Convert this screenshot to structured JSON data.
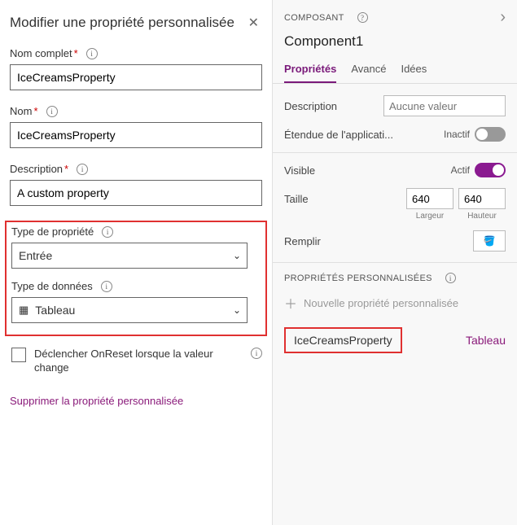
{
  "leftPanel": {
    "title": "Modifier une propriété personnalisée",
    "fields": {
      "fullNameLabel": "Nom complet",
      "fullNameValue": "IceCreamsProperty",
      "nameLabel": "Nom",
      "nameValue": "IceCreamsProperty",
      "descriptionLabel": "Description",
      "descriptionValue": "A custom property",
      "propTypeLabel": "Type de propriété",
      "propTypeValue": "Entrée",
      "dataTypeLabel": "Type de données",
      "dataTypeValue": "Tableau",
      "onResetLabel": "Déclencher OnReset lorsque la valeur change"
    },
    "deleteLink": "Supprimer la propriété personnalisée"
  },
  "rightPanel": {
    "componentLabel": "COMPOSANT",
    "componentName": "Component1",
    "tabs": {
      "properties": "Propriétés",
      "advanced": "Avancé",
      "ideas": "Idées"
    },
    "properties": {
      "descriptionLabel": "Description",
      "descriptionPlaceholder": "Aucune valeur",
      "appScopeLabel": "Étendue de l'applicati...",
      "inactiveLabel": "Inactif",
      "visibleLabel": "Visible",
      "activeLabel": "Actif",
      "sizeLabel": "Taille",
      "widthValue": "640",
      "heightValue": "640",
      "widthLabel": "Largeur",
      "heightLabel": "Hauteur",
      "fillLabel": "Remplir"
    },
    "customSection": {
      "title": "PROPRIÉTÉS PERSONNALISÉES",
      "addNew": "Nouvelle propriété personnalisée",
      "propName": "IceCreamsProperty",
      "propType": "Tableau"
    }
  }
}
